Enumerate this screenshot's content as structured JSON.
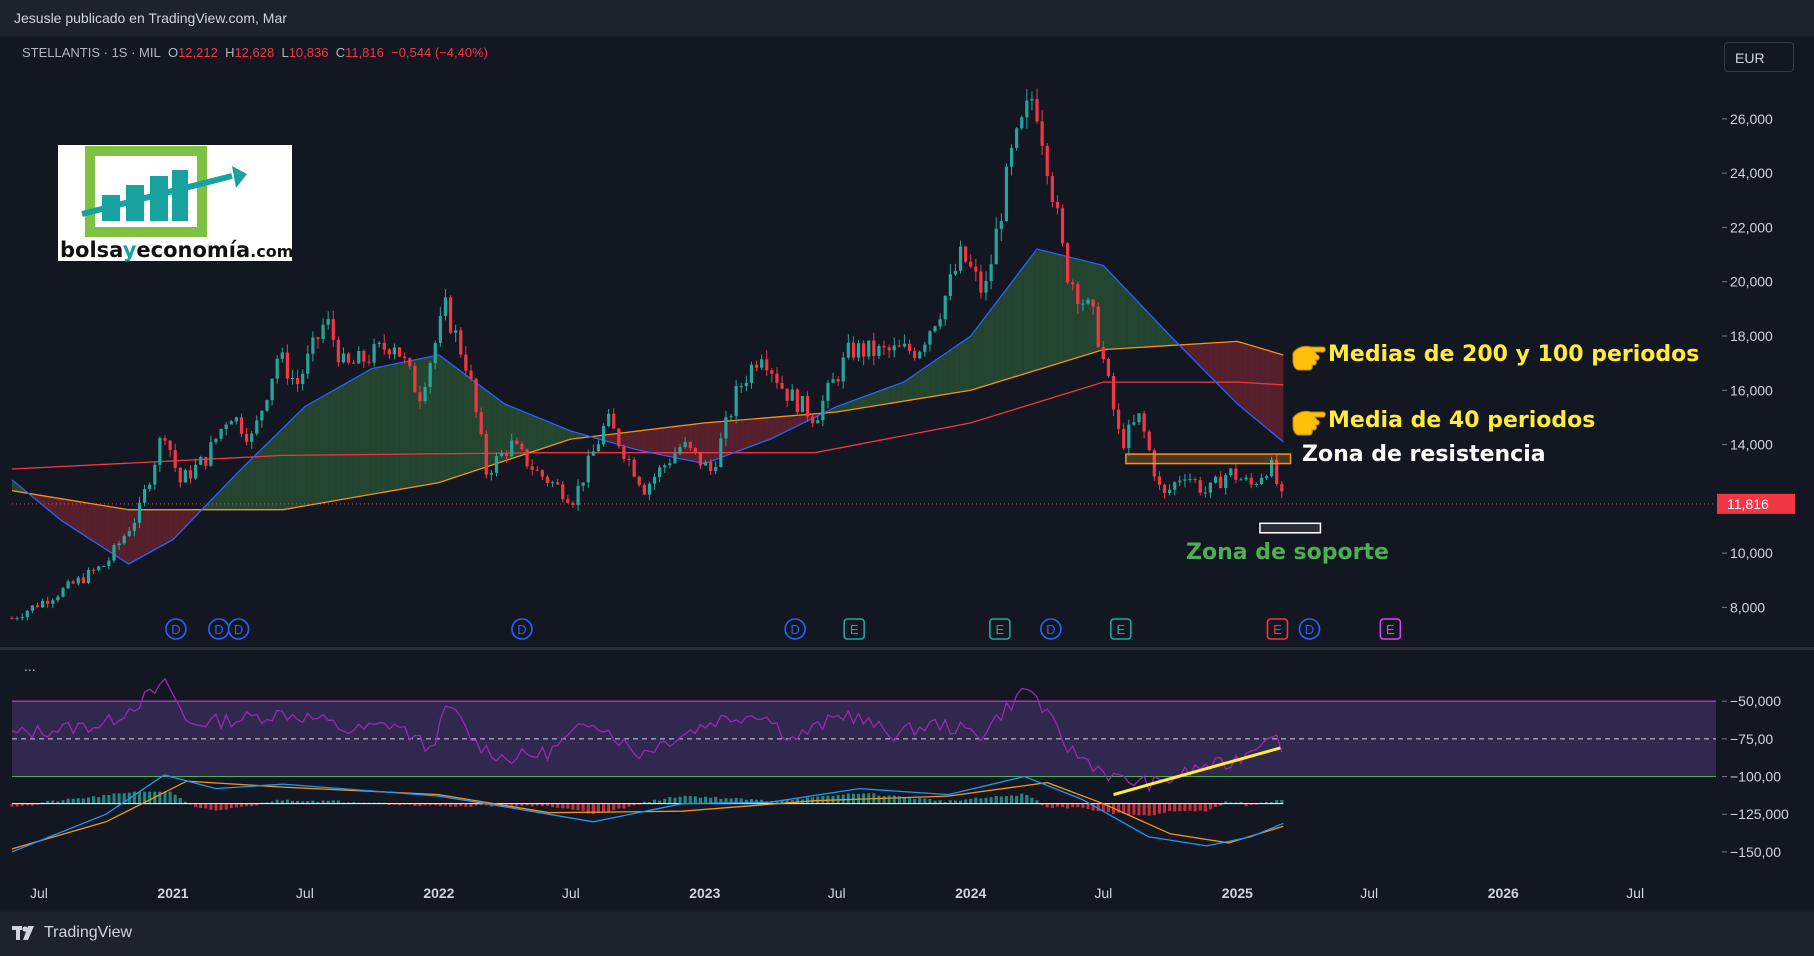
{
  "header": {
    "publisher": "Jesusle publicado en TradingView.com, Mar"
  },
  "legend": {
    "symbol": "STELLANTIS · 1S · MIL",
    "o_label": "O",
    "o_value": "12,212",
    "h_label": "H",
    "h_value": "12,628",
    "l_label": "L",
    "l_value": "10,836",
    "c_label": "C",
    "c_value": "11,816",
    "change": "−0,544 (−4,40%)"
  },
  "currency": "EUR",
  "logo": {
    "text_a": "bolsa",
    "text_b": "y",
    "text_c": "economía",
    "text_d": ".com"
  },
  "indicator_menu": "...",
  "footer": {
    "brand": "TradingView"
  },
  "annotations": {
    "ma200_100": "Medias de 200 y 100 periodos",
    "ma40": "Media de 40 periodos",
    "resistance": "Zona de resistencia",
    "support": "Zona de soporte"
  },
  "colors": {
    "up": "#26a69a",
    "down": "#f23645",
    "ma40": "#2962ff",
    "ma100": "#f7931a",
    "ma200": "#f23645",
    "rsi": "#9c27b0",
    "annotation_yellow": "#ffeb3b",
    "support_text": "#4caf50"
  },
  "chart_data": [
    {
      "type": "candlestick",
      "symbol": "STELLANTIS",
      "interval": "1S",
      "currency": "EUR",
      "last_price": 11.816,
      "price_label": "11,816",
      "y_ticks": [
        "26,000",
        "24,000",
        "22,000",
        "20,000",
        "18,000",
        "16,000",
        "14,000",
        "12,000",
        "10,000",
        "8,000"
      ],
      "y_tick_values": [
        26,
        24,
        22,
        20,
        18,
        16,
        14,
        12,
        10,
        8
      ],
      "ylim": [
        6.8,
        27.8
      ],
      "x_ticks": [
        "Jul",
        "2021",
        "Jul",
        "2022",
        "Jul",
        "2023",
        "Jul",
        "2024",
        "Jul",
        "2025",
        "Jul",
        "2026",
        "Jul"
      ],
      "x_tick_dates": [
        "2020-07",
        "2021-01",
        "2021-07",
        "2022-01",
        "2022-07",
        "2023-01",
        "2023-07",
        "2024-01",
        "2024-07",
        "2025-01",
        "2025-07",
        "2026-01",
        "2026-07"
      ],
      "xlim": [
        "2020-05-25",
        "2026-10-20"
      ],
      "price_path": [
        [
          "2020-05-25",
          7.6
        ],
        [
          "2020-08-01",
          8.6
        ],
        [
          "2020-10-01",
          9.6
        ],
        [
          "2020-11-15",
          11.5
        ],
        [
          "2020-12-20",
          14.6
        ],
        [
          "2021-01-10",
          12.6
        ],
        [
          "2021-02-15",
          13.5
        ],
        [
          "2021-03-20",
          15.2
        ],
        [
          "2021-04-20",
          14.2
        ],
        [
          "2021-05-25",
          17.3
        ],
        [
          "2021-06-20",
          16.2
        ],
        [
          "2021-07-30",
          18.6
        ],
        [
          "2021-08-25",
          16.8
        ],
        [
          "2021-10-01",
          17.3
        ],
        [
          "2021-11-01",
          17.8
        ],
        [
          "2021-12-05",
          15.8
        ],
        [
          "2022-01-10",
          19.0
        ],
        [
          "2022-02-10",
          16.8
        ],
        [
          "2022-03-07",
          13.0
        ],
        [
          "2022-04-10",
          14.0
        ],
        [
          "2022-05-15",
          13.0
        ],
        [
          "2022-07-05",
          12.0
        ],
        [
          "2022-08-20",
          14.9
        ],
        [
          "2022-10-10",
          12.4
        ],
        [
          "2022-12-01",
          14.0
        ],
        [
          "2023-01-10",
          13.0
        ],
        [
          "2023-02-15",
          16.0
        ],
        [
          "2023-03-20",
          17.5
        ],
        [
          "2023-04-20",
          16.0
        ],
        [
          "2023-06-01",
          15.0
        ],
        [
          "2023-07-20",
          17.5
        ],
        [
          "2023-09-01",
          17.4
        ],
        [
          "2023-10-20",
          17.5
        ],
        [
          "2023-11-20",
          19.0
        ],
        [
          "2023-12-20",
          21.0
        ],
        [
          "2024-01-20",
          19.5
        ],
        [
          "2024-02-25",
          24.5
        ],
        [
          "2024-03-28",
          27.0
        ],
        [
          "2024-04-15",
          24.5
        ],
        [
          "2024-05-10",
          20.5
        ],
        [
          "2024-06-20",
          18.5
        ],
        [
          "2024-07-25",
          14.0
        ],
        [
          "2024-08-20",
          15.0
        ],
        [
          "2024-09-20",
          12.0
        ],
        [
          "2024-10-20",
          13.0
        ],
        [
          "2024-11-20",
          12.2
        ],
        [
          "2024-12-20",
          13.0
        ],
        [
          "2025-01-20",
          12.5
        ],
        [
          "2025-02-15",
          13.3
        ],
        [
          "2025-03-05",
          11.816
        ]
      ],
      "ma40": [
        [
          "2020-05-25",
          12.7
        ],
        [
          "2020-08-01",
          11.2
        ],
        [
          "2020-11-01",
          9.6
        ],
        [
          "2021-01-01",
          10.5
        ],
        [
          "2021-04-01",
          13.0
        ],
        [
          "2021-07-01",
          15.4
        ],
        [
          "2021-10-01",
          16.8
        ],
        [
          "2022-01-01",
          17.3
        ],
        [
          "2022-04-01",
          15.5
        ],
        [
          "2022-07-01",
          14.5
        ],
        [
          "2022-10-01",
          13.8
        ],
        [
          "2023-01-01",
          13.3
        ],
        [
          "2023-04-01",
          14.2
        ],
        [
          "2023-07-01",
          15.4
        ],
        [
          "2023-10-01",
          16.3
        ],
        [
          "2024-01-01",
          18.0
        ],
        [
          "2024-04-01",
          21.2
        ],
        [
          "2024-07-01",
          20.6
        ],
        [
          "2024-10-01",
          18.0
        ],
        [
          "2025-01-01",
          15.5
        ],
        [
          "2025-03-05",
          14.1
        ]
      ],
      "ma100": [
        [
          "2020-05-25",
          12.3
        ],
        [
          "2020-11-01",
          11.6
        ],
        [
          "2021-06-01",
          11.6
        ],
        [
          "2022-01-01",
          12.6
        ],
        [
          "2022-07-01",
          14.2
        ],
        [
          "2023-01-01",
          14.8
        ],
        [
          "2023-07-01",
          15.2
        ],
        [
          "2024-01-01",
          16.0
        ],
        [
          "2024-07-01",
          17.5
        ],
        [
          "2025-01-01",
          17.8
        ],
        [
          "2025-03-05",
          17.3
        ]
      ],
      "ma200": [
        [
          "2020-05-25",
          13.1
        ],
        [
          "2021-06-01",
          13.6
        ],
        [
          "2022-06-01",
          13.7
        ],
        [
          "2023-06-01",
          13.7
        ],
        [
          "2024-01-01",
          14.8
        ],
        [
          "2024-07-01",
          16.3
        ],
        [
          "2025-01-01",
          16.3
        ],
        [
          "2025-03-05",
          16.2
        ]
      ],
      "resistance_zone": {
        "from": "2024-08-01",
        "to": "2025-03-15",
        "low": 13.3,
        "high": 13.65
      },
      "support_zone": {
        "from": "2025-02-01",
        "to": "2025-04-25",
        "low": 10.75,
        "high": 11.1
      },
      "events": [
        {
          "date": "2021-01-05",
          "label": "D"
        },
        {
          "date": "2021-03-05",
          "label": "D"
        },
        {
          "date": "2021-04-01",
          "label": "D"
        },
        {
          "date": "2022-04-25",
          "label": "D"
        },
        {
          "date": "2023-05-05",
          "label": "D"
        },
        {
          "date": "2023-07-25",
          "label": "E"
        },
        {
          "date": "2024-02-10",
          "label": "E"
        },
        {
          "date": "2024-04-20",
          "label": "D"
        },
        {
          "date": "2024-07-25",
          "label": "E"
        },
        {
          "date": "2025-02-25",
          "label": "E"
        },
        {
          "date": "2025-04-10",
          "label": "D"
        },
        {
          "date": "2025-07-30",
          "label": "E"
        }
      ]
    },
    {
      "type": "line",
      "name": "oscillator",
      "y_ticks": [
        "−50,000",
        "−75,00",
        "−100,00",
        "−125,000",
        "−150,00"
      ],
      "y_tick_values": [
        -50,
        -75,
        -100,
        -125,
        -150
      ],
      "ylim": [
        -162,
        -28
      ],
      "band_upper": -50,
      "band_mid": -75,
      "band_lower": -100,
      "rsi": [
        [
          "2020-05-25",
          -72
        ],
        [
          "2020-10-01",
          -65
        ],
        [
          "2020-12-25",
          -38
        ],
        [
          "2021-01-20",
          -65
        ],
        [
          "2021-04-01",
          -62
        ],
        [
          "2021-06-01",
          -58
        ],
        [
          "2021-07-20",
          -62
        ],
        [
          "2021-09-01",
          -70
        ],
        [
          "2021-11-01",
          -65
        ],
        [
          "2021-12-20",
          -82
        ],
        [
          "2022-01-15",
          -52
        ],
        [
          "2022-02-20",
          -78
        ],
        [
          "2022-04-01",
          -88
        ],
        [
          "2022-06-01",
          -84
        ],
        [
          "2022-08-01",
          -62
        ],
        [
          "2022-10-01",
          -85
        ],
        [
          "2022-12-01",
          -72
        ],
        [
          "2023-01-20",
          -62
        ],
        [
          "2023-03-20",
          -58
        ],
        [
          "2023-05-01",
          -75
        ],
        [
          "2023-07-15",
          -58
        ],
        [
          "2023-09-15",
          -72
        ],
        [
          "2023-11-15",
          -65
        ],
        [
          "2024-01-15",
          -72
        ],
        [
          "2024-03-20",
          -40
        ],
        [
          "2024-05-15",
          -82
        ],
        [
          "2024-07-20",
          -102
        ],
        [
          "2024-09-15",
          -105
        ],
        [
          "2024-11-15",
          -93
        ],
        [
          "2024-12-20",
          -92
        ],
        [
          "2025-01-20",
          -82
        ],
        [
          "2025-02-20",
          -68
        ],
        [
          "2025-03-05",
          -90
        ]
      ],
      "macd": [
        [
          "2020-05-25",
          -150
        ],
        [
          "2020-10-01",
          -125
        ],
        [
          "2020-12-20",
          -99
        ],
        [
          "2021-03-01",
          -108
        ],
        [
          "2021-06-01",
          -105
        ],
        [
          "2022-01-01",
          -113
        ],
        [
          "2022-04-01",
          -120
        ],
        [
          "2022-08-01",
          -130
        ],
        [
          "2022-12-01",
          -118
        ],
        [
          "2023-04-01",
          -117
        ],
        [
          "2023-08-01",
          -108
        ],
        [
          "2023-12-01",
          -112
        ],
        [
          "2024-03-15",
          -100
        ],
        [
          "2024-06-01",
          -115
        ],
        [
          "2024-09-01",
          -140
        ],
        [
          "2024-11-20",
          -146
        ],
        [
          "2025-01-20",
          -140
        ],
        [
          "2025-03-05",
          -131
        ]
      ],
      "signal": [
        [
          "2020-05-25",
          -148
        ],
        [
          "2020-10-01",
          -130
        ],
        [
          "2021-01-20",
          -103
        ],
        [
          "2021-06-01",
          -107
        ],
        [
          "2022-01-01",
          -112
        ],
        [
          "2022-06-01",
          -124
        ],
        [
          "2022-12-01",
          -123
        ],
        [
          "2023-06-01",
          -116
        ],
        [
          "2023-12-01",
          -113
        ],
        [
          "2024-04-15",
          -104
        ],
        [
          "2024-07-01",
          -118
        ],
        [
          "2024-10-01",
          -138
        ],
        [
          "2024-12-20",
          -144
        ],
        [
          "2025-03-05",
          -133
        ]
      ],
      "trendline": [
        [
          "2024-07-15",
          -112
        ],
        [
          "2025-03-01",
          -81
        ]
      ]
    }
  ]
}
